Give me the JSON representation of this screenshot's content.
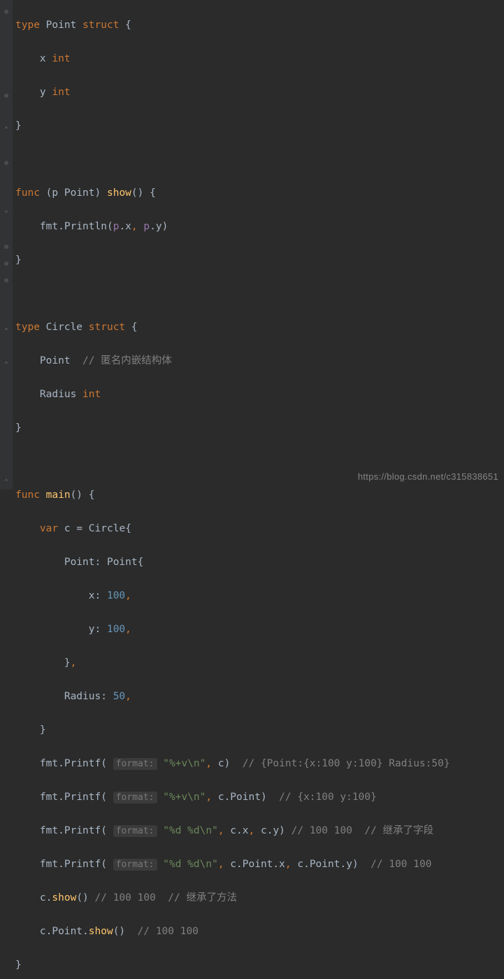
{
  "gutter_icons": [
    {
      "line": 0,
      "glyph": "⊖"
    },
    {
      "line": 5,
      "glyph": "⊖"
    },
    {
      "line": 7,
      "glyph": "⌃"
    },
    {
      "line": 9,
      "glyph": "⊖"
    },
    {
      "line": 12,
      "glyph": "⌃"
    },
    {
      "line": 14,
      "glyph": "⊖"
    },
    {
      "line": 15,
      "glyph": "⊖"
    },
    {
      "line": 16,
      "glyph": "⊖"
    },
    {
      "line": 19,
      "glyph": "⌃"
    },
    {
      "line": 21,
      "glyph": "⌃"
    },
    {
      "line": 28,
      "glyph": "⌃"
    }
  ],
  "kw": {
    "type": "type",
    "struct": "struct",
    "func": "func",
    "var": "var",
    "int": "int"
  },
  "names": {
    "Point": "Point",
    "Circle": "Circle",
    "Radius": "Radius",
    "x": "x",
    "y": "y",
    "p": "p",
    "c": "c",
    "show": "show",
    "main": "main",
    "fmt": "fmt",
    "Println": "Println",
    "Printf": "Printf"
  },
  "nums": {
    "n100": "100",
    "n50": "50"
  },
  "strs": {
    "vfmt": "\"%+v\\n\"",
    "dfmt": "\"%d %d\\n\""
  },
  "hints": {
    "format": "format:"
  },
  "comments": {
    "anon_embed": "// 匿名内嵌结构体",
    "out1": "// {Point:{x:100 y:100} Radius:50}",
    "out2": "// {x:100 y:100}",
    "out3a": "// 100 100",
    "inherit_field": "// 继承了字段",
    "out4a": "// 100 100",
    "out5": "// 100 100",
    "inherit_method": "// 继承了方法",
    "out6": "// 100 100"
  },
  "watermark": "https://blog.csdn.net/c315838651"
}
